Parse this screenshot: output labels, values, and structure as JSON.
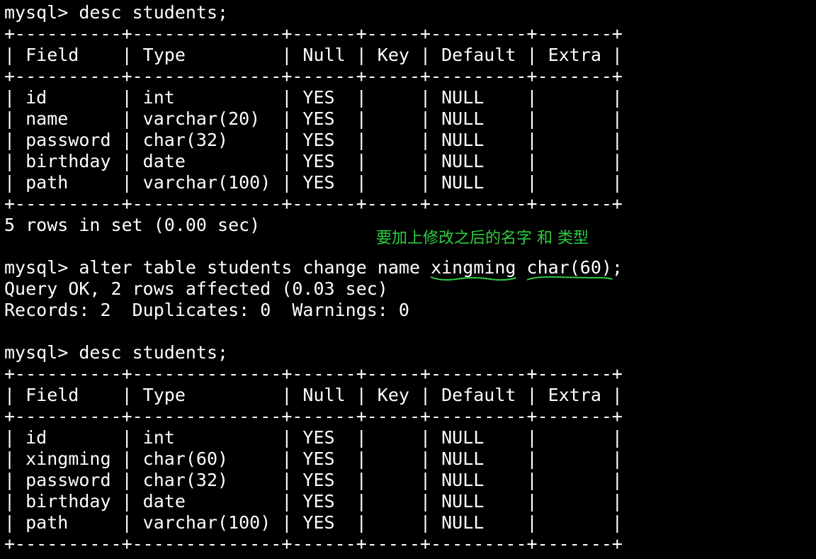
{
  "terminal": {
    "lines": [
      "mysql> desc students;",
      "+----------+--------------+------+-----+---------+-------+",
      "| Field    | Type         | Null | Key | Default | Extra |",
      "+----------+--------------+------+-----+---------+-------+",
      "| id       | int          | YES  |     | NULL    |       |",
      "| name     | varchar(20)  | YES  |     | NULL    |       |",
      "| password | char(32)     | YES  |     | NULL    |       |",
      "| birthday | date         | YES  |     | NULL    |       |",
      "| path     | varchar(100) | YES  |     | NULL    |       |",
      "+----------+--------------+------+-----+---------+-------+",
      "5 rows in set (0.00 sec)",
      "",
      "mysql> alter table students change name ",
      "Query OK, 2 rows affected (0.03 sec)",
      "Records: 2  Duplicates: 0  Warnings: 0",
      "",
      "mysql> desc students;",
      "+----------+--------------+------+-----+---------+-------+",
      "| Field    | Type         | Null | Key | Default | Extra |",
      "+----------+--------------+------+-----+---------+-------+",
      "| id       | int          | YES  |     | NULL    |       |",
      "| xingming | char(60)     | YES  |     | NULL    |       |",
      "| password | char(32)     | YES  |     | NULL    |       |",
      "| birthday | date         | YES  |     | NULL    |       |",
      "| path     | varchar(100) | YES  |     | NULL    |       |",
      "+----------+--------------+------+-----+---------+-------+"
    ],
    "alter_new_name": "xingming",
    "alter_space": " ",
    "alter_new_type": "char(60)",
    "alter_end": ";"
  },
  "annotation": {
    "text": "要加上修改之后的名字 和 类型"
  },
  "colors": {
    "background": "#000000",
    "text": "#ffffff",
    "annotation": "#2ecc40"
  }
}
